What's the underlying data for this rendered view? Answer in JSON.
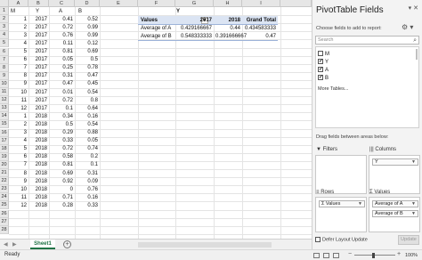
{
  "sheet": {
    "col_headers": [
      "A",
      "B",
      "C",
      "D",
      "E",
      "F",
      "G",
      "H",
      "I"
    ],
    "row_numbers": [
      "1",
      "2",
      "3",
      "4",
      "5",
      "6",
      "7",
      "8",
      "9",
      "10",
      "11",
      "12",
      "13",
      "14",
      "15",
      "16",
      "17",
      "18",
      "19",
      "20",
      "21",
      "22",
      "23",
      "24",
      "25",
      "26",
      "27",
      "28"
    ],
    "data_headers": {
      "M": "M",
      "Y": "Y",
      "A": "A",
      "B": "B"
    },
    "rows": [
      {
        "m": "1",
        "y": "2017",
        "a": "0.41",
        "b": "0.52"
      },
      {
        "m": "2",
        "y": "2017",
        "a": "0.72",
        "b": "0.99"
      },
      {
        "m": "3",
        "y": "2017",
        "a": "0.76",
        "b": "0.99"
      },
      {
        "m": "4",
        "y": "2017",
        "a": "0.11",
        "b": "0.12"
      },
      {
        "m": "5",
        "y": "2017",
        "a": "0.81",
        "b": "0.69"
      },
      {
        "m": "6",
        "y": "2017",
        "a": "0.05",
        "b": "0.5"
      },
      {
        "m": "7",
        "y": "2017",
        "a": "0.25",
        "b": "0.78"
      },
      {
        "m": "8",
        "y": "2017",
        "a": "0.31",
        "b": "0.47"
      },
      {
        "m": "9",
        "y": "2017",
        "a": "0.47",
        "b": "0.45"
      },
      {
        "m": "10",
        "y": "2017",
        "a": "0.01",
        "b": "0.54"
      },
      {
        "m": "11",
        "y": "2017",
        "a": "0.72",
        "b": "0.8"
      },
      {
        "m": "12",
        "y": "2017",
        "a": "0.1",
        "b": "0.64"
      },
      {
        "m": "1",
        "y": "2018",
        "a": "0.34",
        "b": "0.16"
      },
      {
        "m": "2",
        "y": "2018",
        "a": "0.5",
        "b": "0.54"
      },
      {
        "m": "3",
        "y": "2018",
        "a": "0.29",
        "b": "0.88"
      },
      {
        "m": "4",
        "y": "2018",
        "a": "0.33",
        "b": "0.05"
      },
      {
        "m": "5",
        "y": "2018",
        "a": "0.72",
        "b": "0.74"
      },
      {
        "m": "6",
        "y": "2018",
        "a": "0.58",
        "b": "0.2"
      },
      {
        "m": "7",
        "y": "2018",
        "a": "0.81",
        "b": "0.1"
      },
      {
        "m": "8",
        "y": "2018",
        "a": "0.69",
        "b": "0.31"
      },
      {
        "m": "9",
        "y": "2018",
        "a": "0.92",
        "b": "0.09"
      },
      {
        "m": "10",
        "y": "2018",
        "a": "0",
        "b": "0.76"
      },
      {
        "m": "11",
        "y": "2018",
        "a": "0.71",
        "b": "0.16"
      },
      {
        "m": "12",
        "y": "2018",
        "a": "0.28",
        "b": "0.33"
      }
    ]
  },
  "pivot": {
    "header_y": "Y",
    "dropdown_glyph": "▼",
    "header_values": "Values",
    "col_2017": "2017",
    "col_2018": "2018",
    "col_grand": "Grand Total",
    "row1": {
      "label": "Average of A",
      "v2017": "0.429166667",
      "v2018": "0.44",
      "grand": "0.434583333"
    },
    "row2": {
      "label": "Average of B",
      "v2017": "0.548333333",
      "v2018": "0.391666667",
      "grand": "0.47"
    }
  },
  "tabbar": {
    "sheet_tab": "Sheet1",
    "add_sheet": "+",
    "prev": "◀",
    "next": "▶"
  },
  "status": {
    "ready": "Ready",
    "zoom_minus": "−",
    "zoom_plus": "+",
    "zoom": "100%"
  },
  "pane": {
    "title": "PivotTable Fields",
    "controls": "▾ ✕",
    "choose_hint": "Choose fields to add to report:",
    "gear": "⚙ ▾",
    "search_placeholder": "Search",
    "search_glyph": "⌕",
    "fields": [
      {
        "label": "M",
        "checked": false
      },
      {
        "label": "Y",
        "checked": true
      },
      {
        "label": "A",
        "checked": true
      },
      {
        "label": "B",
        "checked": true
      }
    ],
    "more_tables": "More Tables...",
    "drag_hint": "Drag fields between areas below:",
    "filters_label": "Filters",
    "columns_label": "Columns",
    "rows_label": "Rows",
    "values_label": "Values",
    "filters_glyph": "▼",
    "columns_glyph": "|||",
    "rows_glyph": "≡",
    "values_glyph": "Σ",
    "columns_item": "Y",
    "rows_item": "Σ Values",
    "values_items": [
      "Average of A",
      "Average of B"
    ],
    "pill_arrow": "▼",
    "defer_label": "Defer Layout Update",
    "update_button": "Update"
  }
}
